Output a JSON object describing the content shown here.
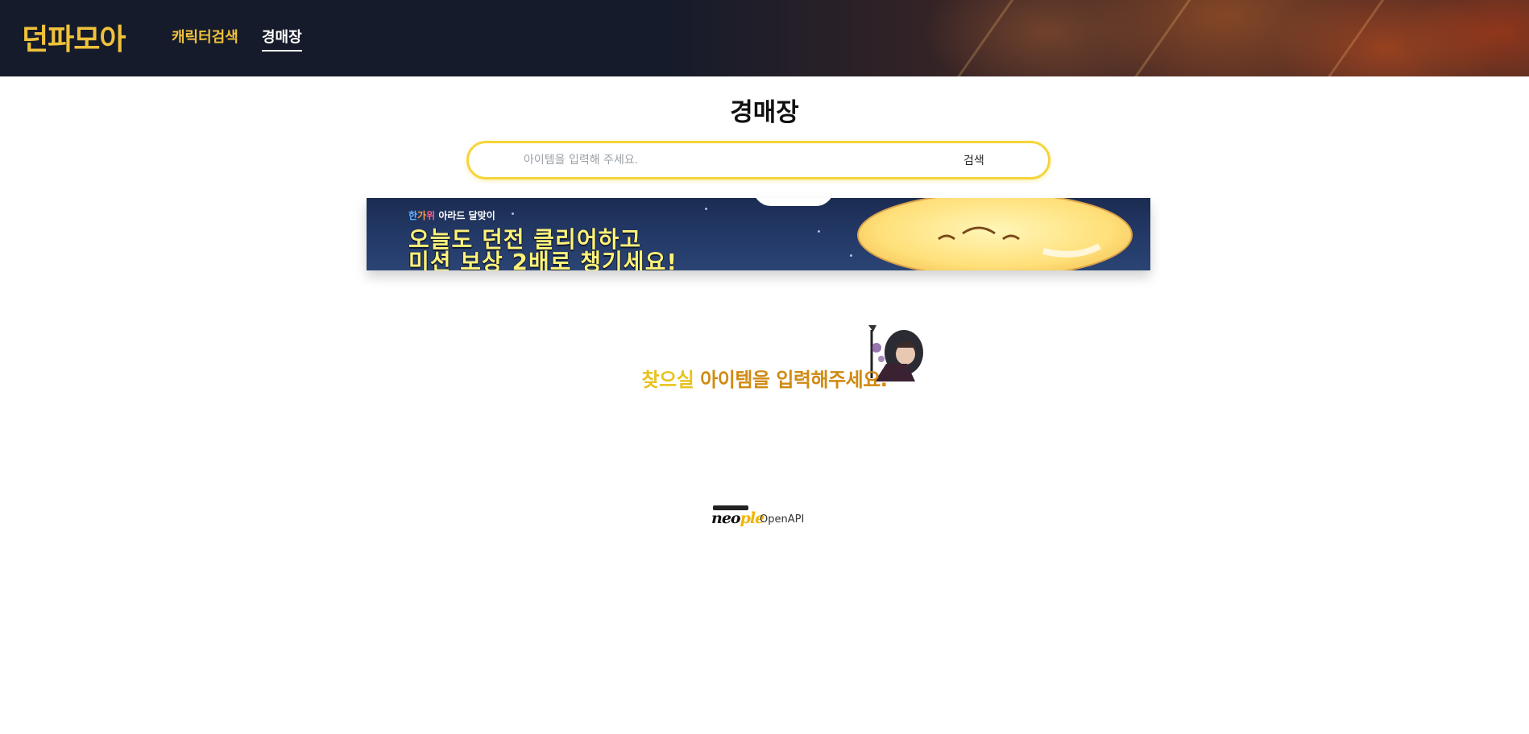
{
  "header": {
    "logo": "던파모아",
    "nav": [
      {
        "label": "캐릭터검색",
        "color": "#f0c23b"
      },
      {
        "label": "경매장",
        "color": "#ffffff",
        "active": true
      }
    ]
  },
  "main": {
    "title": "경매장",
    "search": {
      "placeholder": "아이템을 입력해 주세요.",
      "value": "",
      "button_label": "검색"
    },
    "banner": {
      "tag_1": "한",
      "tag_2": "가",
      "tag_3": "위",
      "tag_rest": " 아라드 달맞이",
      "line1": "오늘도 던전 클리어하고",
      "line2": "미션 보상 2배로 챙기세요!"
    },
    "empty_state": {
      "text_part1": "찾으실 ",
      "text_part2": "아이템을 입력해주세요."
    }
  },
  "footer": {
    "brand_neo": "neo",
    "brand_p": "p",
    "brand_le": "le",
    "openapi": "OpenAPI"
  },
  "colors": {
    "accent": "#f0c23b",
    "search_border": "#f5d53a",
    "header_bg": "#151b2a"
  }
}
